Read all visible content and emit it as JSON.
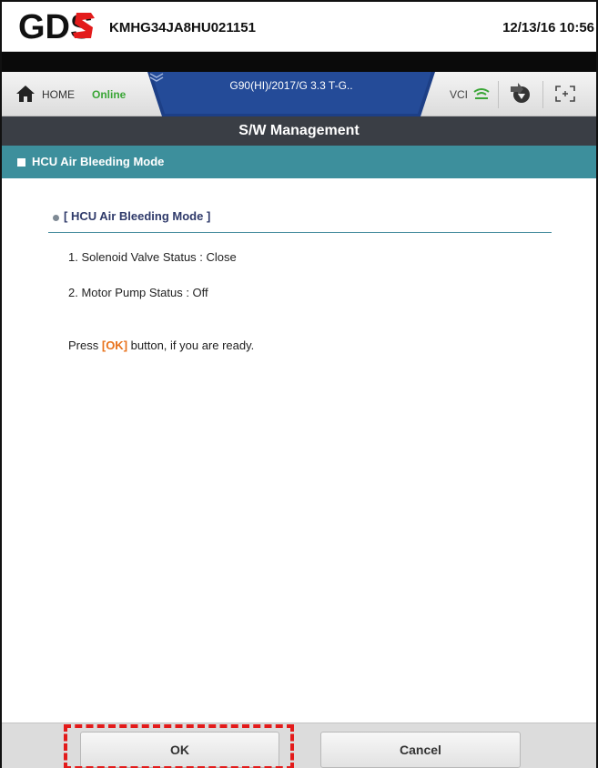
{
  "status_bar": {
    "logo_text": "GDS",
    "vin": "KMHG34JA8HU021151",
    "datetime": "12/13/16 10:56"
  },
  "toolbar": {
    "home_label": "HOME",
    "connection_status": "Online",
    "vehicle": "G90(HI)/2017/G 3.3 T-G..",
    "vci_label": "VCI"
  },
  "title": "S/W Management",
  "section": {
    "title": "HCU Air Bleeding Mode"
  },
  "content": {
    "subtitle": "[ HCU Air Bleeding Mode ]",
    "lines": [
      "1. Solenoid Valve Status : Close",
      "2. Motor Pump Status : Off"
    ],
    "instruction_prefix": "Press",
    "instruction_highlight": "[OK]",
    "instruction_suffix": "button, if you are ready."
  },
  "footer": {
    "ok_label": "OK",
    "cancel_label": "Cancel"
  },
  "colors": {
    "title_bar": "#3a3e45",
    "section_header": "#3d8f9c",
    "online": "#3aa636",
    "ok_highlight": "#e8721c",
    "annotation": "#e31b1b"
  }
}
